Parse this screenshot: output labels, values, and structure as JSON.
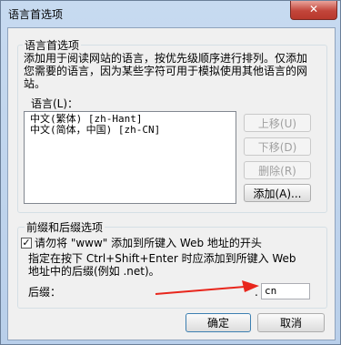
{
  "window": {
    "title": "语言首选项",
    "close_glyph": "✕"
  },
  "language_group": {
    "title": "语言首选项",
    "description_line1": "添加用于阅读网站的语言，按优先级顺序进行排列。仅添加",
    "description_line2": "您需要的语言，因为某些字符可用于模拟使用其他语言的网",
    "description_line3": "站。",
    "list_label": "语言(L)：",
    "languages": [
      "中文(繁体) [zh-Hant]",
      "中文(简体，中国) [zh-CN]"
    ],
    "buttons": {
      "move_up": "上移(U)",
      "move_down": "下移(D)",
      "remove": "删除(R)",
      "add": "添加(A)..."
    }
  },
  "prefix_suffix_group": {
    "title": "前缀和后缀选项",
    "checkbox_label": "请勿将 \"www\" 添加到所键入 Web 地址的开头",
    "checkbox_checked": "✓",
    "info_line1": "指定在按下 Ctrl+Shift+Enter 时应添加到所键入 Web",
    "info_line2": "地址中的后缀(例如 .net)。",
    "suffix_label": "后缀：",
    "suffix_dot": ".",
    "suffix_value": "cn"
  },
  "dialog_buttons": {
    "ok": "确定",
    "cancel": "取消"
  },
  "annotation": {
    "arrow_color": "#e8261c"
  }
}
